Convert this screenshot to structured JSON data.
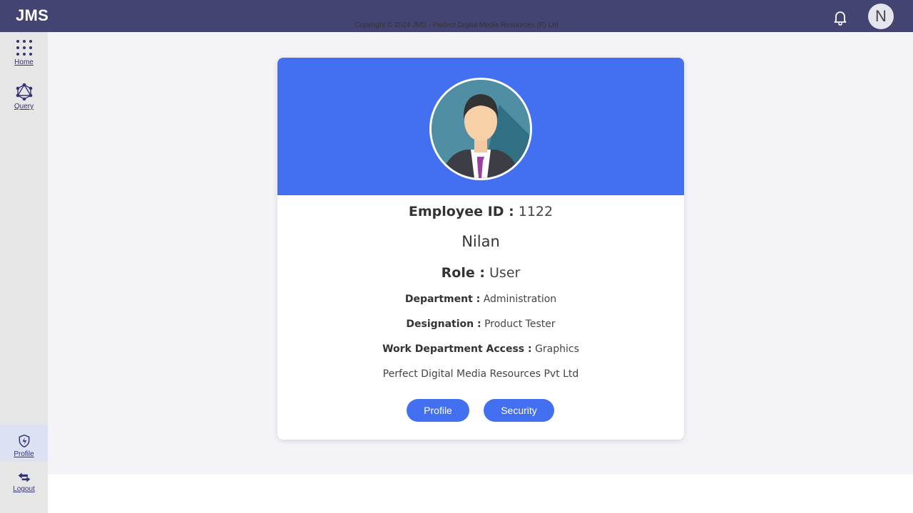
{
  "app": {
    "brand": "JMS",
    "user_initial": "N"
  },
  "sidebar": {
    "items": [
      {
        "label": "Home",
        "icon": "grid-dots-icon"
      },
      {
        "label": "Query",
        "icon": "graph-network-icon"
      }
    ],
    "bottom_items": [
      {
        "label": "Profile",
        "icon": "shield-bolt-icon",
        "active": true
      },
      {
        "label": "Logout",
        "icon": "logout-arrows-icon"
      }
    ]
  },
  "profile": {
    "employee_id_label": "Employee ID :",
    "employee_id": "1122",
    "name": "Nilan",
    "role_label": "Role :",
    "role": "User",
    "department_label": "Department :",
    "department": "Administration",
    "designation_label": "Designation :",
    "designation": "Product Tester",
    "work_access_label": "Work Department Access :",
    "work_access": "Graphics",
    "company": "Perfect Digital Media Resources Pvt Ltd",
    "buttons": {
      "profile": "Profile",
      "security": "Security"
    }
  },
  "footer": {
    "copyright": "Copyright © 2024 JMS - Perfect Digital Media Resources (P) Ltd"
  },
  "colors": {
    "topbar": "#444472",
    "accent": "#4270f0",
    "sidebar": "#e6e6e6",
    "background": "#f3f3f8"
  }
}
